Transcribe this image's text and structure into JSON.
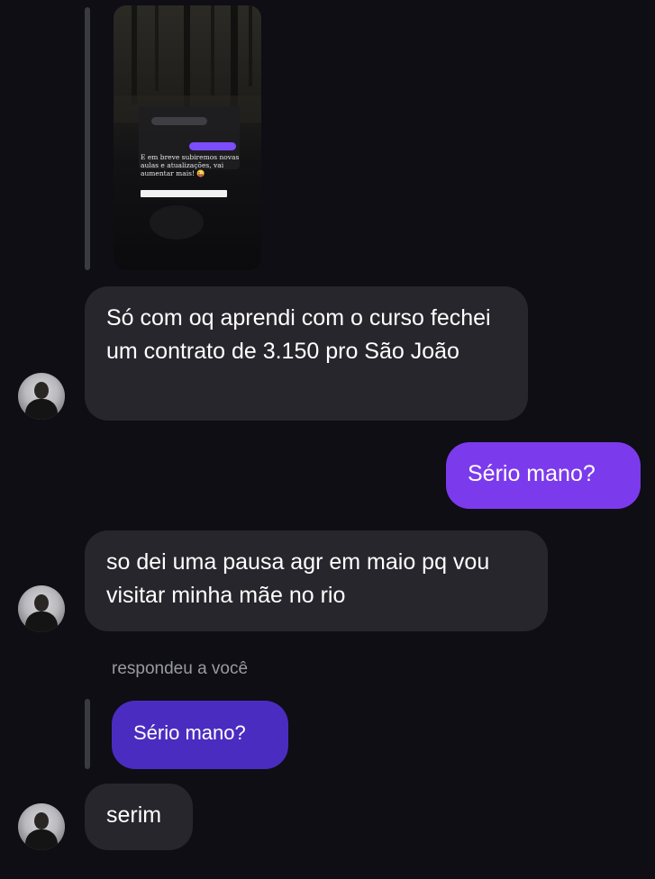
{
  "story_reply": {
    "story_text": "E em breve subiremos novas aulas e atualizações, vai aumentar mais! 😜"
  },
  "messages": [
    {
      "sender": "other",
      "text": "Só com oq aprendi com o curso fechei um contrato de 3.150 pro São João"
    },
    {
      "sender": "me",
      "text": "Sério mano?"
    },
    {
      "sender": "other",
      "text": "so dei uma pausa agr em maio pq vou visitar minha mãe no rio"
    },
    {
      "sender": "other",
      "reply_caption": "respondeu a você",
      "quoted_text": "Sério mano?"
    },
    {
      "sender": "other",
      "text": "serim"
    }
  ],
  "colors": {
    "background": "#0e0e14",
    "incoming_bubble": "#26262c",
    "outgoing_bubble": "#7c3aed",
    "quoted_bubble": "#4b2cc0"
  }
}
